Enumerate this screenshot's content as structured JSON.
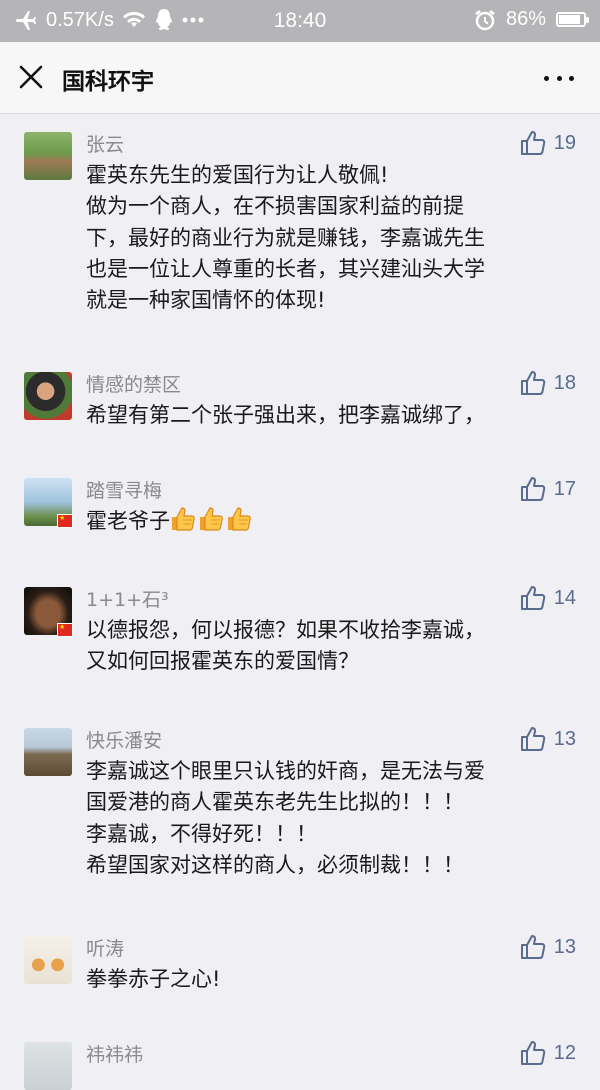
{
  "status_bar": {
    "speed": "0.57K/s",
    "time": "18:40",
    "battery": "86%",
    "battery_level": 0.86,
    "icons": [
      "airplane-icon",
      "wifi-icon",
      "qq-icon",
      "more-dots-icon",
      "alarm-icon",
      "battery-icon"
    ]
  },
  "navbar": {
    "title": "国科环宇",
    "close_icon": "close-icon",
    "more_icon": "more-icon"
  },
  "accent": "#596b8e",
  "comments": [
    {
      "name": "张云",
      "likes": "19",
      "lines": [
        "霍英东先生的爱国行为让人敬佩!",
        "做为一个商人，在不损害国家利益的前提",
        "下，最好的商业行为就是赚钱，李嘉诚先生",
        "也是一位让人尊重的长者，其兴建汕头大学",
        "就是一种家国情怀的体现!"
      ]
    },
    {
      "name": "情感的禁区",
      "likes": "18",
      "lines": [
        "希望有第二个张子强出来，把李嘉诚绑了，"
      ]
    },
    {
      "name": "踏雪寻梅",
      "likes": "17",
      "lines": [
        "霍老爷子"
      ],
      "emoji": [
        "thumbs-up-emoji",
        "thumbs-up-emoji",
        "thumbs-up-emoji"
      ]
    },
    {
      "name": "1+1+石³",
      "likes": "14",
      "lines": [
        "以德报怨，何以报德？如果不收拾李嘉诚，",
        "又如何回报霍英东的爱国情？"
      ]
    },
    {
      "name": "快乐潘安",
      "likes": "13",
      "lines": [
        "李嘉诚这个眼里只认钱的奸商，是无法与爱",
        "国爱港的商人霍英东老先生比拟的！！！",
        "李嘉诚，不得好死！！！",
        "希望国家对这样的商人，必须制裁！！！"
      ]
    },
    {
      "name": "听涛",
      "likes": "13",
      "lines": [
        "拳拳赤子之心!"
      ]
    },
    {
      "name": "祎祎祎",
      "likes": "12",
      "lines": []
    }
  ]
}
